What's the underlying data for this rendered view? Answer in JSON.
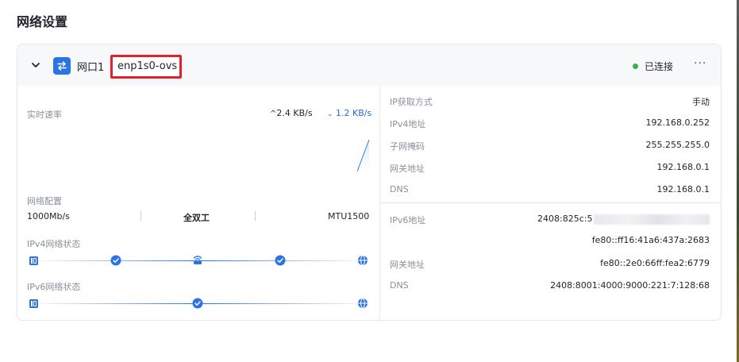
{
  "page": {
    "title": "网络设置"
  },
  "port": {
    "name": "网口1",
    "interface": "enp1s0-ovs",
    "status": "已连接",
    "status_color": "#37b24d",
    "more_label": "···"
  },
  "realtime": {
    "label": "实时速率",
    "upload": "2.4 KB/s",
    "download": "1.2 KB/s"
  },
  "net_config": {
    "label": "网络配置",
    "speed": "1000Mb/s",
    "duplex": "全双工",
    "mtu": "MTU1500"
  },
  "ipv4_status": {
    "label": "IPv4网络状态"
  },
  "ipv6_status": {
    "label": "IPv6网络状态"
  },
  "ipv4": {
    "rows": [
      {
        "label": "IP获取方式",
        "value": "手动"
      },
      {
        "label": "IPv4地址",
        "value": "192.168.0.252"
      },
      {
        "label": "子网掩码",
        "value": "255.255.255.0"
      },
      {
        "label": "网关地址",
        "value": "192.168.0.1"
      },
      {
        "label": "DNS",
        "value": "192.168.0.1"
      }
    ]
  },
  "ipv6": {
    "address_label": "IPv6地址",
    "address_1": "2408:825c:5",
    "address_2": "fe80::ff16:41a6:437a:2683",
    "gateway_label": "网关地址",
    "gateway": "fe80::2e0:66ff:fea2:6779",
    "dns_label": "DNS",
    "dns": "2408:8001:4000:9000:221:7:128:68"
  },
  "colors": {
    "accent": "#2a74e3",
    "alert_border": "#e3212b"
  }
}
